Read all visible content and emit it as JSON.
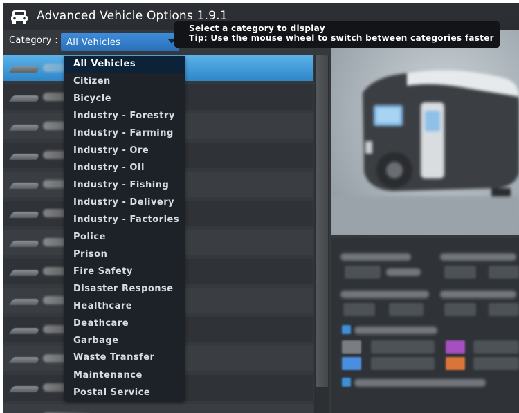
{
  "window": {
    "title": "Advanced Vehicle Options 1.9.1"
  },
  "category": {
    "label": "Category :",
    "selected": "All Vehicles",
    "options": [
      "All Vehicles",
      "Citizen",
      "Bicycle",
      "Industry - Forestry",
      "Industry - Farming",
      "Industry - Ore",
      "Industry - Oil",
      "Industry - Fishing",
      "Industry - Delivery",
      "Industry - Factories",
      "Police",
      "Prison",
      "Fire Safety",
      "Disaster Response",
      "Healthcare",
      "Deathcare",
      "Garbage",
      "Waste Transfer",
      "Maintenance",
      "Postal Service"
    ]
  },
  "tooltip": {
    "line1": "Select a category to display",
    "line2": "Tip: Use the mouse wheel to switch between categories faster"
  },
  "colors": {
    "accent": "#3f8ddb",
    "selected_row": "#4aa3e0",
    "dropdown_bg": "#1d2228",
    "window_bg": "#35393d",
    "swatch_gray": "#7a7e82",
    "swatch_purple": "#a54fc0",
    "swatch_blue": "#4a8ee0",
    "swatch_orange": "#d9743a"
  },
  "icons": {
    "app": "car-front-icon",
    "dropdown": "chevron-down-icon"
  }
}
